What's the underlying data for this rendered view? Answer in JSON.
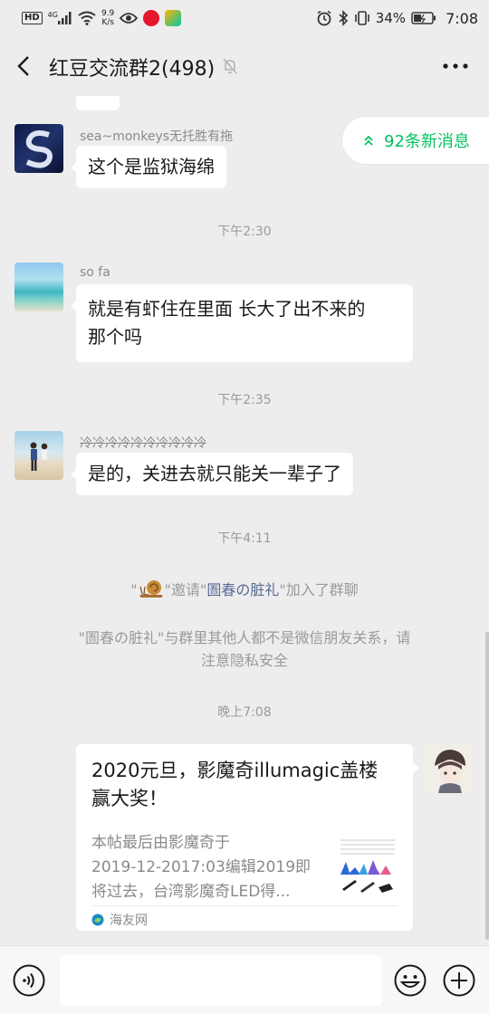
{
  "status_bar": {
    "hd": "HD",
    "network": "4G",
    "speed_value": "9.9",
    "speed_unit": "K/s",
    "battery": "34%",
    "time": "7:08"
  },
  "header": {
    "title": "红豆交流群2(498)"
  },
  "new_messages": {
    "label": "92条新消息"
  },
  "messages": [
    {
      "nickname": "sea~monkeys无托胜有拖",
      "text": "这个是监狱海绵"
    },
    {
      "time": "下午2:30"
    },
    {
      "nickname": "so fa",
      "text_line1": "就是有虾住在里面 长大了出不来的",
      "text_line2": "那个吗"
    },
    {
      "time": "下午2:35"
    },
    {
      "nickname": "冷冷冷冷冷冷冷冷冷冷",
      "text": "是的，关进去就只能关一辈子了"
    },
    {
      "time": "下午4:11"
    },
    {
      "system_pre": "\"",
      "system_inviter_end": "\"邀请\"",
      "system_name": "圄春の脏礼",
      "system_post": "\"加入了群聊"
    },
    {
      "system_line1": "\"圄春の脏礼\"与群里其他人都不是微信朋友关系，请",
      "system_line2": "注意隐私安全"
    },
    {
      "time": "晚上7:08"
    }
  ],
  "link_card": {
    "title_line1": "2020元旦，影魔奇illumagic盖楼",
    "title_line2": "赢大奖！",
    "desc_line1": "本帖最后由影魔奇于",
    "desc_line2": "2019-12-2017:03编辑2019即",
    "desc_line3": "将过去，台湾影魔奇LED得...",
    "source": "海友网"
  },
  "icons": {
    "back": "chevron-left-icon",
    "mute": "mute-bell-icon",
    "more": "more-dots-icon",
    "voice": "voice-icon",
    "emoji": "emoji-icon",
    "plus": "plus-icon"
  },
  "colors": {
    "accent": "#07c160",
    "link": "#576b95"
  }
}
